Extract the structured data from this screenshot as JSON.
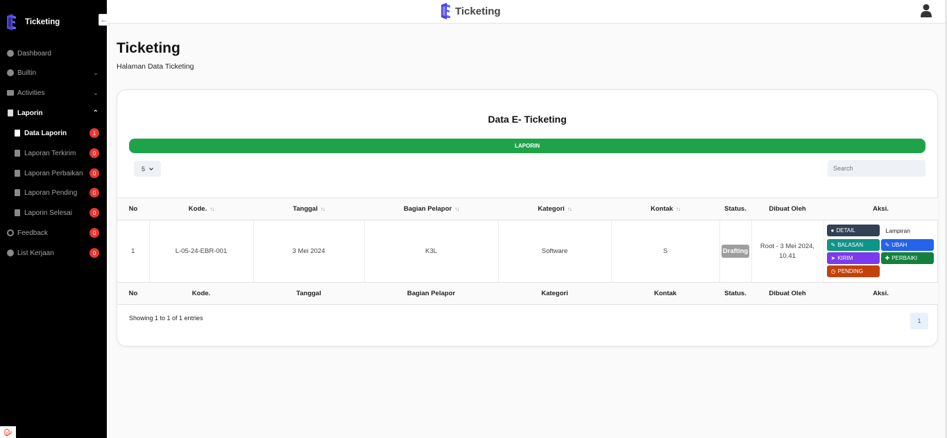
{
  "sidebar": {
    "brand": "Ticketing",
    "collapse_icon": "←",
    "items": [
      {
        "label": "Dashboard",
        "icon": "dashboard-icon"
      },
      {
        "label": "Builtin",
        "icon": "dot-icon",
        "chevron": "⌄"
      },
      {
        "label": "Activities",
        "icon": "card-icon",
        "chevron": "⌄"
      },
      {
        "label": "Laporin",
        "icon": "clipboard-icon",
        "chevron": "⌃"
      },
      {
        "label": "Data Laporin",
        "badge": "1"
      },
      {
        "label": "Laporan Terkirim",
        "badge": "0"
      },
      {
        "label": "Laporan Perbaikan",
        "badge": "0"
      },
      {
        "label": "Laporan Pending",
        "badge": "0"
      },
      {
        "label": "Laporin Selesai",
        "badge": "0"
      },
      {
        "label": "Feedback",
        "badge": "0"
      },
      {
        "label": "List Kerjaan",
        "badge": "0"
      }
    ]
  },
  "topbar": {
    "brand": "Ticketing"
  },
  "page": {
    "title": "Ticketing",
    "subtitle": "Halaman Data Ticketing"
  },
  "card": {
    "title": "Data E- Ticketing",
    "banner": "LAPORIN",
    "length_value": "5",
    "search_placeholder": "Search",
    "columns": [
      "No",
      "Kode.",
      "Tanggal",
      "Bagian Pelapor",
      "Kategori",
      "Kontak",
      "Status.",
      "Dibuat Oleh",
      "Aksi."
    ],
    "sort_glyph": "↑↓",
    "rows": [
      {
        "no": "1",
        "kode": "L-05-24-EBR-001",
        "tanggal": "3 Mei 2024",
        "bagian": "K3L",
        "kategori": "Software",
        "kontak": "S",
        "status": "Drafting",
        "dibuat_line1": "Root - 3 Mei 2024,",
        "dibuat_line2": "10.41"
      }
    ],
    "actions": {
      "detail": "DETAIL",
      "lampiran": "Lampiran",
      "balasan": "BALASAN",
      "ubah": "UBAH",
      "kirim": "KIRIM",
      "perbaiki": "PERBAIKI",
      "pending": "PENDING"
    },
    "info": "Showing 1 to 1 of 1 entries",
    "page": "1"
  },
  "colors": {
    "sidebar_bg": "#000000",
    "green": "#1fa34a",
    "detail": "#334155",
    "balasan": "#0f9488",
    "ubah": "#2563eb",
    "kirim": "#7c3aed",
    "perbaiki": "#15803d",
    "pending": "#c2410c",
    "badge": "#e53935"
  }
}
